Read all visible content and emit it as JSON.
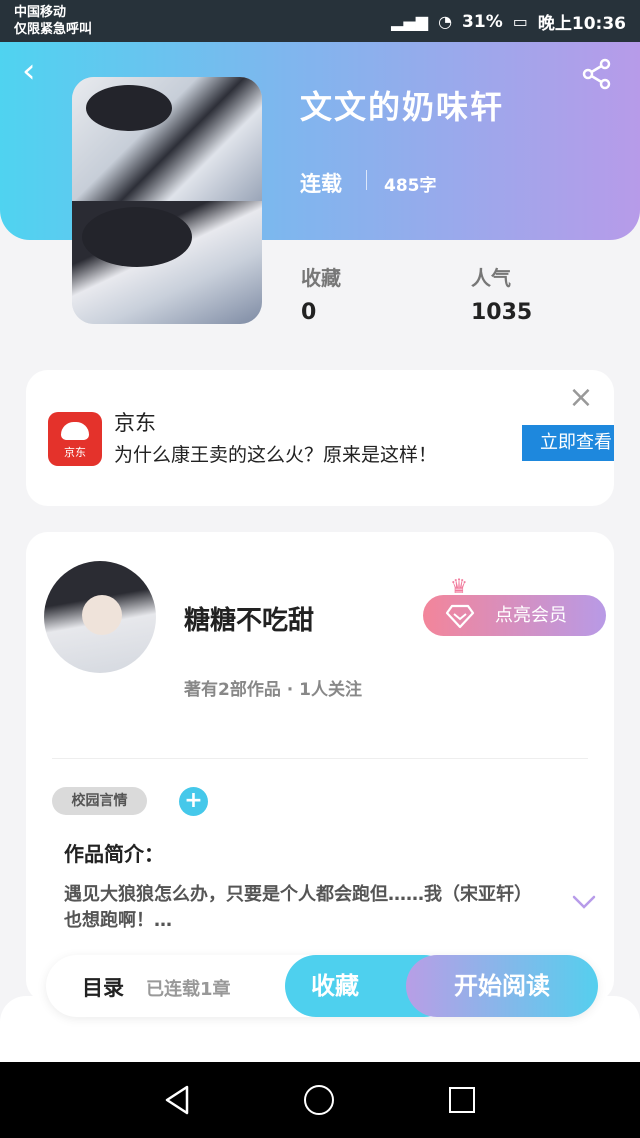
{
  "status_bar": {
    "carrier_line1": "中国移动",
    "carrier_line2": "仅限紧急呼叫",
    "battery": "31%",
    "time": "晚上10:36"
  },
  "header": {
    "title": "文文的奶味轩",
    "status": "连载",
    "word_count": "485字",
    "stats": [
      {
        "label": "收藏",
        "value": "0"
      },
      {
        "label": "人气",
        "value": "1035"
      }
    ]
  },
  "ad": {
    "brand": "京东",
    "logo_text": "京东",
    "text": "为什么康王卖的这么火？原来是这样！",
    "cta": "立即查看"
  },
  "author": {
    "name": "糖糖不吃甜",
    "meta": "著有2部作品 · 1人关注",
    "vip_label": "点亮会员"
  },
  "work": {
    "tag": "校园言情",
    "intro_title": "作品简介：",
    "intro_text": "遇见大狼狼怎么办，只要是个人都会跑但……我（宋亚轩）也想跑啊！…"
  },
  "actions": {
    "toc_label": "目录",
    "toc_count": "已连载1章",
    "favorite": "收藏",
    "read": "开始阅读"
  },
  "colors": {
    "header_start": "#4fd3f0",
    "header_end": "#b79be9",
    "accent_cyan": "#4ed0ee",
    "ad_red": "#e4322b",
    "ad_blue": "#1e88dd"
  },
  "icons": [
    "back-icon",
    "share-icon",
    "close-icon",
    "plus-icon",
    "chevron-down-icon",
    "gem-icon",
    "crown-icon"
  ]
}
